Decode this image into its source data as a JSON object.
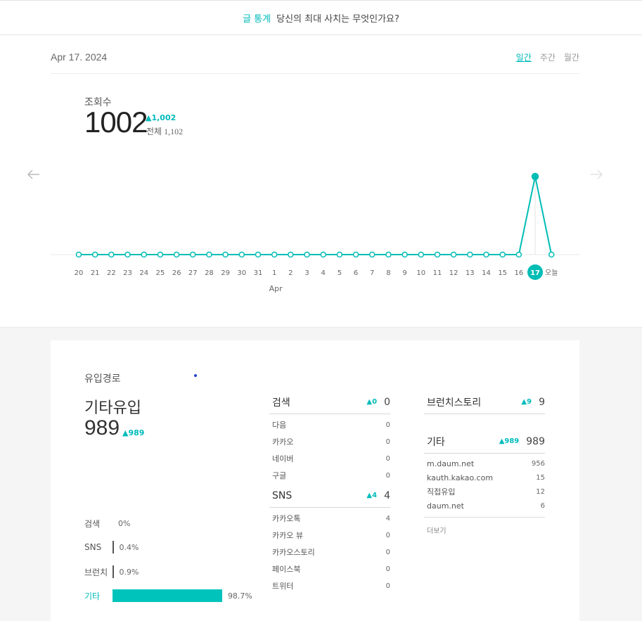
{
  "header": {
    "badge": "글 통계",
    "post_title": "당신의 최대 사치는 무엇인가요?"
  },
  "date_bar": {
    "date": "Apr 17. 2024",
    "tabs": [
      {
        "label": "일간",
        "active": true
      },
      {
        "label": "주간",
        "active": false
      },
      {
        "label": "월간",
        "active": false
      }
    ]
  },
  "views": {
    "label": "조회수",
    "value": "1002",
    "delta": "1,002",
    "total": "전체 1,102"
  },
  "colors": {
    "accent": "#00bbbb",
    "line": "#00bdb5"
  },
  "chart_data": {
    "type": "line",
    "x": [
      "20",
      "21",
      "22",
      "23",
      "24",
      "25",
      "26",
      "27",
      "28",
      "29",
      "30",
      "31",
      "1",
      "2",
      "3",
      "4",
      "5",
      "6",
      "7",
      "8",
      "9",
      "10",
      "11",
      "12",
      "13",
      "14",
      "15",
      "16",
      "17",
      "오늘"
    ],
    "values": [
      0,
      0,
      0,
      0,
      0,
      0,
      0,
      0,
      0,
      0,
      0,
      0,
      0,
      0,
      0,
      0,
      0,
      0,
      0,
      0,
      0,
      0,
      0,
      0,
      0,
      0,
      0,
      0,
      1002,
      0
    ],
    "month_label": "Apr",
    "highlight_index": 28,
    "xlabel": "",
    "ylabel": ""
  },
  "inflow": {
    "title": "유입경로",
    "top_category": "기타유입",
    "top_value": "989",
    "top_delta": "989",
    "shares": [
      {
        "label": "검색",
        "pct": "0%",
        "value": 0,
        "highlight": false
      },
      {
        "label": "SNS",
        "pct": "0.4%",
        "value": 0.4,
        "highlight": false
      },
      {
        "label": "브런치",
        "pct": "0.9%",
        "value": 0.9,
        "highlight": false
      },
      {
        "label": "기타",
        "pct": "98.7%",
        "value": 98.7,
        "highlight": true
      }
    ]
  },
  "search": {
    "title": "검색",
    "delta": "0",
    "value": "0",
    "rows": [
      {
        "name": "다음",
        "value": "0"
      },
      {
        "name": "카카오",
        "value": "0"
      },
      {
        "name": "네이버",
        "value": "0"
      },
      {
        "name": "구글",
        "value": "0"
      }
    ]
  },
  "sns": {
    "title": "SNS",
    "delta": "4",
    "value": "4",
    "rows": [
      {
        "name": "카카오톡",
        "value": "4"
      },
      {
        "name": "카카오 뷰",
        "value": "0"
      },
      {
        "name": "카카오스토리",
        "value": "0"
      },
      {
        "name": "페이스북",
        "value": "0"
      },
      {
        "name": "트위터",
        "value": "0"
      }
    ]
  },
  "brunch": {
    "title": "브런치스토리",
    "delta": "9",
    "value": "9"
  },
  "etc": {
    "title": "기타",
    "delta": "989",
    "value": "989",
    "rows": [
      {
        "name": "m.daum.net",
        "value": "956"
      },
      {
        "name": "kauth.kakao.com",
        "value": "15"
      },
      {
        "name": "직접유입",
        "value": "12"
      },
      {
        "name": "daum.net",
        "value": "6"
      }
    ],
    "more": "더보기"
  }
}
